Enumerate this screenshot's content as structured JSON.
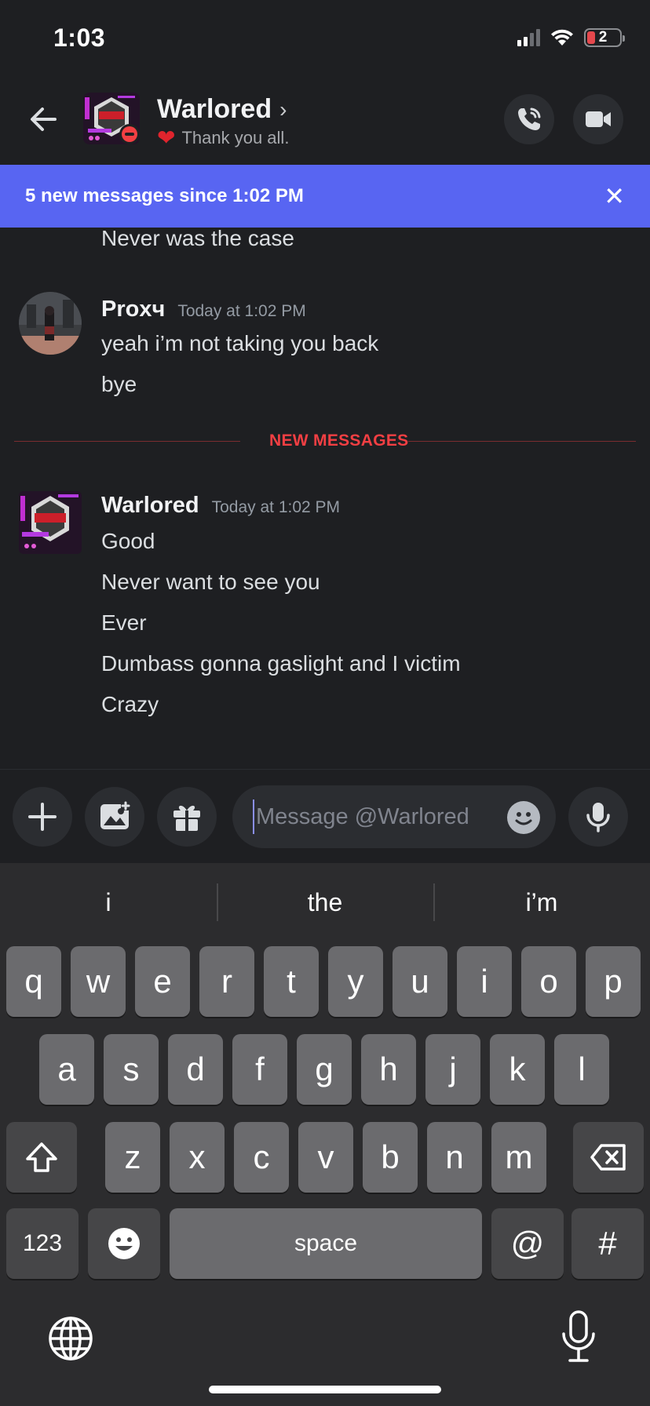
{
  "status_bar": {
    "time": "1:03",
    "battery": "2"
  },
  "header": {
    "name": "Warlored",
    "chevron": "›",
    "status_emoji": "❤",
    "status_text": "Thank you all.",
    "back_icon": "arrow-left-icon",
    "call_icon": "phone-call-icon",
    "video_icon": "video-camera-icon"
  },
  "banner": {
    "text": "5 new messages since 1:02 PM",
    "close": "✕"
  },
  "chat": {
    "prev_line": "Never was the case",
    "messages": [
      {
        "author": "Proxч",
        "timestamp": "Today at 1:02 PM",
        "lines": [
          "yeah i’m not taking you back",
          "bye"
        ]
      },
      {
        "author": "Warlored",
        "timestamp": "Today at 1:02 PM",
        "lines": [
          "Good",
          "Never want to see you",
          "Ever",
          "Dumbass gonna gaslight and I victim",
          "Crazy"
        ]
      }
    ],
    "divider_label": "NEW MESSAGES"
  },
  "composer": {
    "placeholder": "Message @Warlored",
    "buttons": [
      "plus-icon",
      "image-icon",
      "gift-icon",
      "microphone-icon"
    ]
  },
  "keyboard": {
    "suggestions": [
      "i",
      "the",
      "i’m"
    ],
    "row1": [
      "q",
      "w",
      "e",
      "r",
      "t",
      "y",
      "u",
      "i",
      "o",
      "p"
    ],
    "row2": [
      "a",
      "s",
      "d",
      "f",
      "g",
      "h",
      "j",
      "k",
      "l"
    ],
    "row3": [
      "z",
      "x",
      "c",
      "v",
      "b",
      "n",
      "m"
    ],
    "bottom": {
      "numbers": "123",
      "space": "space",
      "at": "@",
      "hash": "#"
    }
  },
  "colors": {
    "accent": "#5865f2",
    "danger": "#f23f43",
    "background": "#1e1f22",
    "keyboard": "#2c2c2e"
  }
}
